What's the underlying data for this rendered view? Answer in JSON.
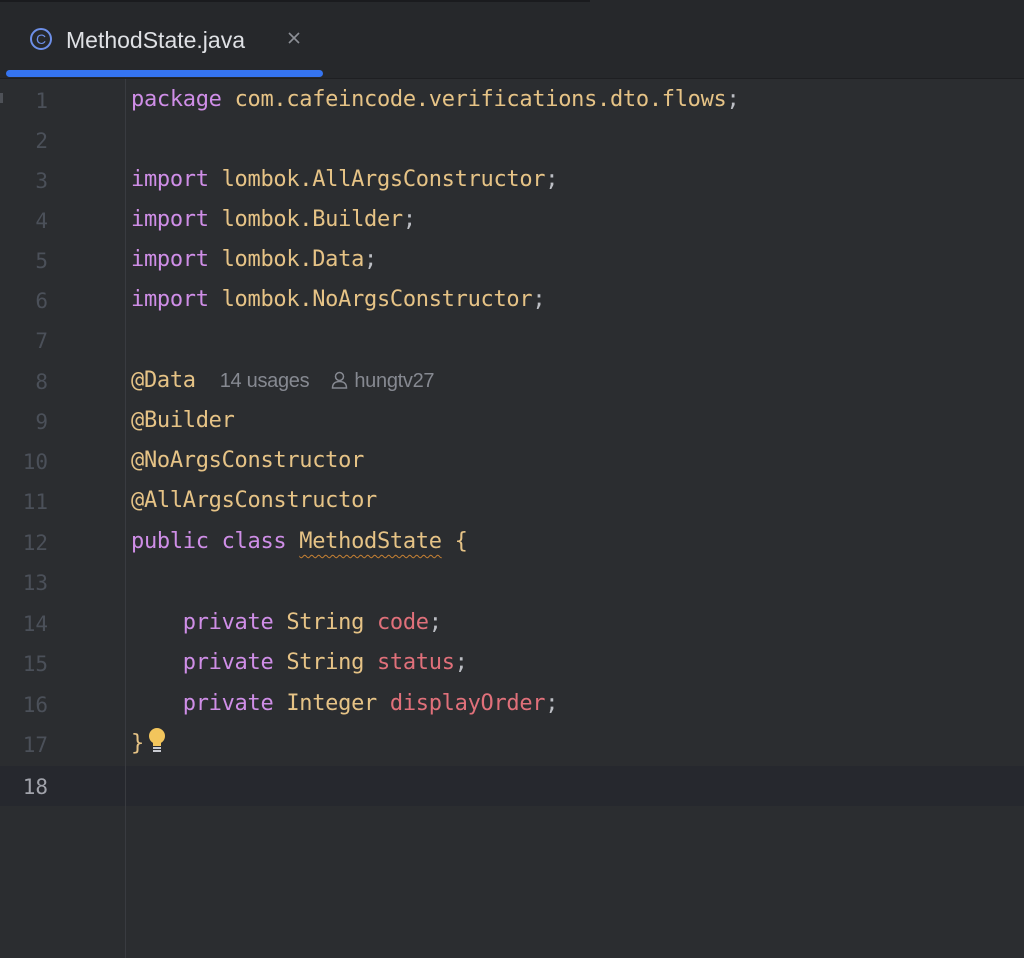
{
  "tab": {
    "title": "MethodState.java",
    "icon": "class-icon",
    "close_icon": "close-icon",
    "active_color": "#3574f0"
  },
  "editor": {
    "current_line": 18,
    "lines": [
      {
        "n": "1"
      },
      {
        "n": "2"
      },
      {
        "n": "3"
      },
      {
        "n": "4"
      },
      {
        "n": "5"
      },
      {
        "n": "6"
      },
      {
        "n": "7"
      },
      {
        "n": "8"
      },
      {
        "n": "9"
      },
      {
        "n": "10"
      },
      {
        "n": "11"
      },
      {
        "n": "12"
      },
      {
        "n": "13"
      },
      {
        "n": "14"
      },
      {
        "n": "15"
      },
      {
        "n": "16"
      },
      {
        "n": "17"
      },
      {
        "n": "18"
      }
    ],
    "code": {
      "l1_kw": "package",
      "l1_pkg": " com.cafeincode.verifications.dto.flows",
      "l1_semi": ";",
      "import_kw": "import",
      "l3_pkg": " lombok.AllArgsConstructor",
      "l4_pkg": " lombok.Builder",
      "l5_pkg": " lombok.Data",
      "l6_pkg": " lombok.NoArgsConstructor",
      "semi": ";",
      "l8_ann": "@Data",
      "l8_usages": "14 usages",
      "l8_author": "hungtv27",
      "l9_ann": "@Builder",
      "l10_ann": "@NoArgsConstructor",
      "l11_ann": "@AllArgsConstructor",
      "l12_kw": "public class ",
      "l12_cls": "MethodState",
      "l12_brace": "{",
      "private_kw": "private ",
      "l14_type": "String ",
      "l14_field": "code",
      "l15_type": "String ",
      "l15_field": "status",
      "l16_type": "Integer ",
      "l16_field": "displayOrder",
      "l17_brace": "}"
    }
  },
  "colors": {
    "keyword": "#cf8ee7",
    "annotation": "#e6c386",
    "field": "#e0707a",
    "background": "#2b2d30"
  }
}
